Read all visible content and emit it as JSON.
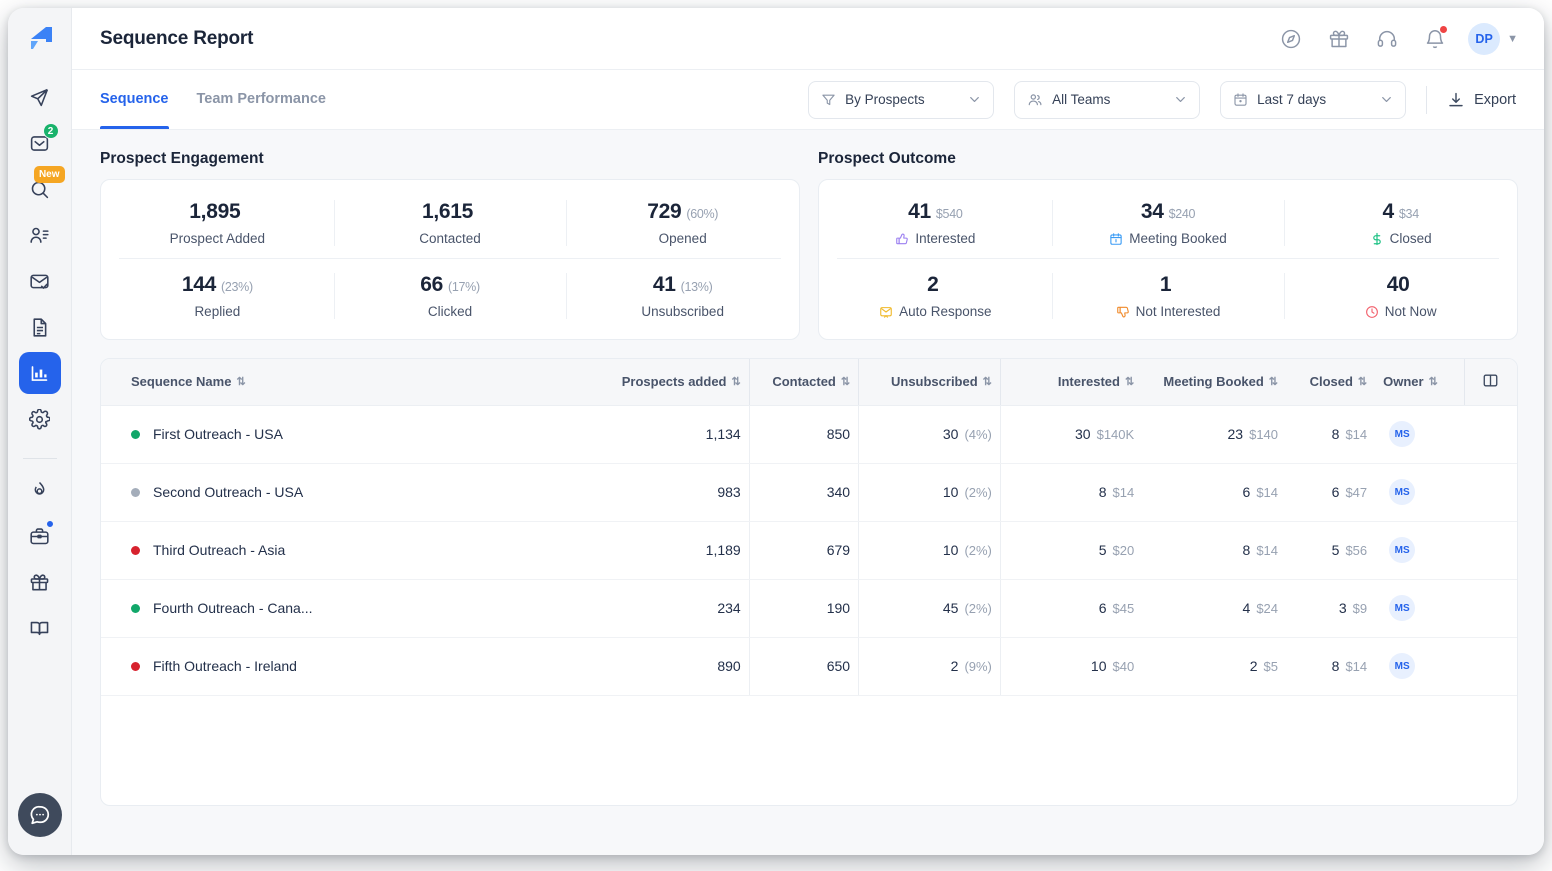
{
  "header": {
    "title": "Sequence Report",
    "right_icons": [
      "compass-icon",
      "gift-icon",
      "headset-icon",
      "bell-icon"
    ],
    "avatar_initials": "DP"
  },
  "sidebar": {
    "logo": "brand-logo",
    "items": [
      {
        "name": "send-icon",
        "badge": ""
      },
      {
        "name": "inbox-icon",
        "badge": "2"
      },
      {
        "name": "search-icon",
        "badge": "New"
      },
      {
        "name": "contacts-icon",
        "badge": ""
      },
      {
        "name": "email-verify-icon",
        "badge": ""
      },
      {
        "name": "document-icon",
        "badge": ""
      },
      {
        "name": "reports-icon",
        "badge": "",
        "active": true
      },
      {
        "name": "settings-icon",
        "badge": ""
      }
    ],
    "bottom_items": [
      {
        "name": "fire-icon",
        "badge": ""
      },
      {
        "name": "briefcase-icon",
        "badge": "dot"
      },
      {
        "name": "gift-icon",
        "badge": ""
      },
      {
        "name": "book-icon",
        "badge": ""
      }
    ],
    "chat_icon": "chat-bubble-icon"
  },
  "tabs": [
    {
      "label": "Sequence",
      "active": true
    },
    {
      "label": "Team Performance",
      "active": false
    }
  ],
  "toolbar": {
    "filter_by": "By Prospects",
    "teams": "All Teams",
    "date_range": "Last 7 days",
    "export_label": "Export"
  },
  "engagement": {
    "title": "Prospect Engagement",
    "stats": [
      {
        "value": "1,895",
        "sub": "",
        "label": "Prospect Added"
      },
      {
        "value": "1,615",
        "sub": "",
        "label": "Contacted"
      },
      {
        "value": "729",
        "sub": "(60%)",
        "label": "Opened"
      },
      {
        "value": "144",
        "sub": "(23%)",
        "label": "Replied"
      },
      {
        "value": "66",
        "sub": "(17%)",
        "label": "Clicked"
      },
      {
        "value": "41",
        "sub": "(13%)",
        "label": "Unsubscribed"
      }
    ]
  },
  "outcome": {
    "title": "Prospect Outcome",
    "stats": [
      {
        "value": "41",
        "sub": "$540",
        "label": "Interested",
        "icon": "thumbs-up-icon",
        "color": "#9b7ff0"
      },
      {
        "value": "34",
        "sub": "$240",
        "label": "Meeting Booked",
        "icon": "calendar-icon",
        "color": "#3b9cf5"
      },
      {
        "value": "4",
        "sub": "$34",
        "label": "Closed",
        "icon": "dollar-icon",
        "color": "#22c387"
      },
      {
        "value": "2",
        "sub": "",
        "label": "Auto Response",
        "icon": "auto-reply-icon",
        "color": "#f0b92a"
      },
      {
        "value": "1",
        "sub": "",
        "label": "Not Interested",
        "icon": "thumbs-down-icon",
        "color": "#f08a2a"
      },
      {
        "value": "40",
        "sub": "",
        "label": "Not Now",
        "icon": "clock-icon",
        "color": "#f2606c"
      }
    ]
  },
  "table": {
    "columns": [
      "Sequence Name",
      "Prospects added",
      "Contacted",
      "Unsubscribed",
      "Interested",
      "Meeting Booked",
      "Closed",
      "Owner"
    ],
    "column_settings_icon": "columns-icon",
    "rows": [
      {
        "status_color": "#12a76a",
        "name": "First Outreach - USA",
        "prospects_added": "1,134",
        "contacted": "850",
        "unsubscribed": "30",
        "unsubscribed_pct": "(4%)",
        "interested": "30",
        "interested_amt": "$140K",
        "meeting_booked": "23",
        "meeting_amt": "$140",
        "closed": "8",
        "closed_amt": "$14",
        "owner": "MS"
      },
      {
        "status_color": "#a4adba",
        "name": "Second Outreach - USA",
        "prospects_added": "983",
        "contacted": "340",
        "unsubscribed": "10",
        "unsubscribed_pct": "(2%)",
        "interested": "8",
        "interested_amt": "$14",
        "meeting_booked": "6",
        "meeting_amt": "$14",
        "closed": "6",
        "closed_amt": "$47",
        "owner": "MS"
      },
      {
        "status_color": "#d7222e",
        "name": "Third Outreach - Asia",
        "prospects_added": "1,189",
        "contacted": "679",
        "unsubscribed": "10",
        "unsubscribed_pct": "(2%)",
        "interested": "5",
        "interested_amt": "$20",
        "meeting_booked": "8",
        "meeting_amt": "$14",
        "closed": "5",
        "closed_amt": "$56",
        "owner": "MS"
      },
      {
        "status_color": "#12a76a",
        "name": "Fourth Outreach - Cana...",
        "prospects_added": "234",
        "contacted": "190",
        "unsubscribed": "45",
        "unsubscribed_pct": "(2%)",
        "interested": "6",
        "interested_amt": "$45",
        "meeting_booked": "4",
        "meeting_amt": "$24",
        "closed": "3",
        "closed_amt": "$9",
        "owner": "MS"
      },
      {
        "status_color": "#d7222e",
        "name": "Fifth Outreach - Ireland",
        "prospects_added": "890",
        "contacted": "650",
        "unsubscribed": "2",
        "unsubscribed_pct": "(9%)",
        "interested": "10",
        "interested_amt": "$40",
        "meeting_booked": "2",
        "meeting_amt": "$5",
        "closed": "8",
        "closed_amt": "$14",
        "owner": "MS"
      }
    ]
  },
  "colors": {
    "accent": "#2563eb",
    "page_bg": "#f7f8fa",
    "text": "#1b2539",
    "muted": "#97a1b1"
  }
}
